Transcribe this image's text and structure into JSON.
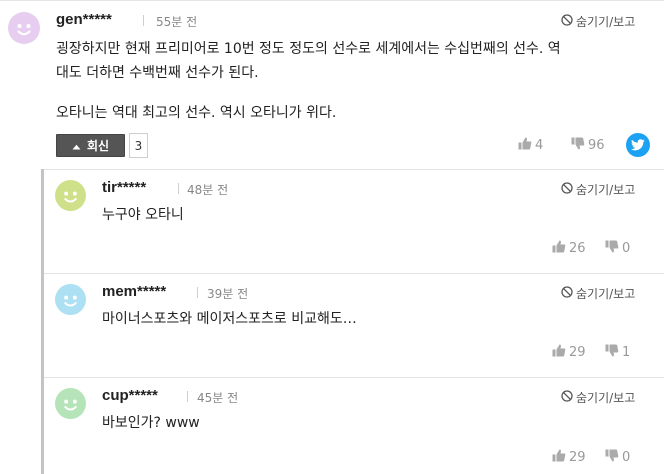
{
  "colors": {
    "twitter": "#1da1f2",
    "reply_button": "#555555"
  },
  "main_comment": {
    "username": "gen*****",
    "time": "55분 전",
    "hide_label": "숨기기/보고",
    "body_lines": [
      "굉장하지만 현재 프리미어로 10번 정도 정도의 선수로 세계에서는 수십번째의 선수. 역",
      "대도 더하면 수백번째 선수가 된다.",
      "",
      "오타니는 역대 최고의 선수. 역시 오타니가 위다."
    ],
    "reply_label": "회신",
    "reply_count": "3",
    "likes": "4",
    "dislikes": "96",
    "avatar_color": "#e7cdf0",
    "share_icon": "twitter-icon"
  },
  "replies": [
    {
      "username": "tir*****",
      "time": "48분 전",
      "hide_label": "숨기기/보고",
      "body": "누구야 오타니",
      "likes": "26",
      "dislikes": "0",
      "avatar_color": "#cfe08a"
    },
    {
      "username": "mem*****",
      "time": "39분 전",
      "hide_label": "숨기기/보고",
      "body": "마이너스포츠와 메이저스포츠로 비교해도…",
      "likes": "29",
      "dislikes": "1",
      "avatar_color": "#aee0f3"
    },
    {
      "username": "cup*****",
      "time": "45분 전",
      "hide_label": "숨기기/보고",
      "body": "바보인가? www",
      "likes": "29",
      "dislikes": "0",
      "avatar_color": "#b5e4b8"
    }
  ]
}
